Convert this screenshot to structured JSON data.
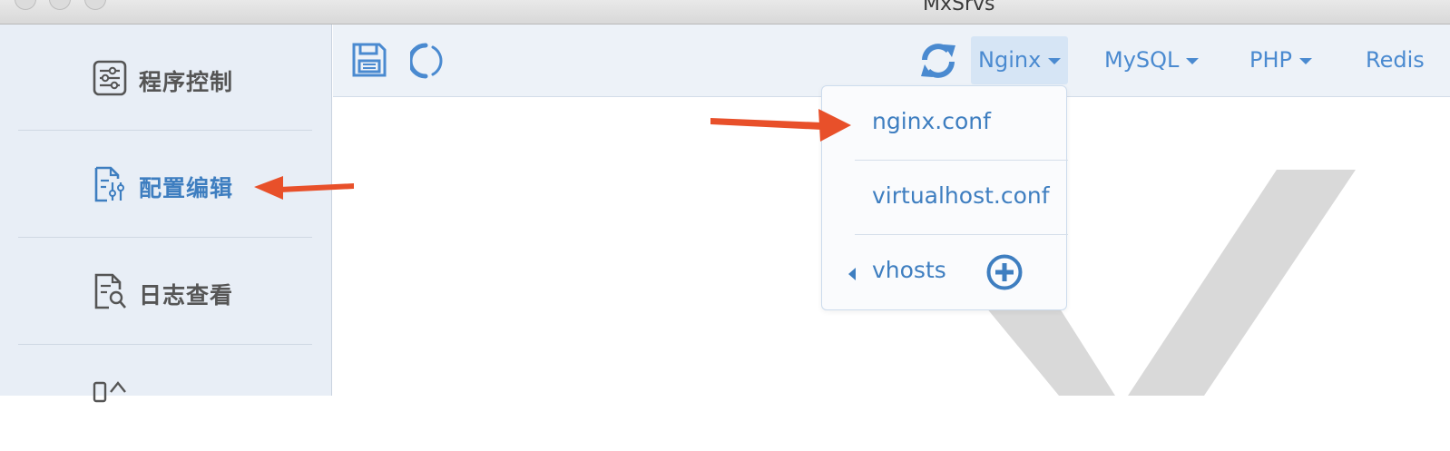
{
  "window": {
    "title": "MxSrvs"
  },
  "sidebar": {
    "items": [
      {
        "label": "程序控制",
        "icon": "sliders-panel-icon",
        "active": false
      },
      {
        "label": "配置编辑",
        "icon": "config-edit-icon",
        "active": true
      },
      {
        "label": "日志查看",
        "icon": "log-view-icon",
        "active": false
      }
    ]
  },
  "toolbar": {
    "save_icon": "save-icon",
    "loading_icon": "loading-spinner-icon",
    "refresh_icon": "refresh-icon",
    "menus": [
      {
        "label": "Nginx",
        "open": true
      },
      {
        "label": "MySQL",
        "open": false
      },
      {
        "label": "PHP",
        "open": false
      },
      {
        "label": "Redis",
        "open": false
      }
    ]
  },
  "dropdown": {
    "items": [
      {
        "label": "nginx.conf"
      },
      {
        "label": "virtualhost.conf"
      },
      {
        "label": "vhosts",
        "has_submenu": true,
        "add_icon": "plus-circle-icon"
      }
    ]
  },
  "colors": {
    "accent": "#3e7ec0",
    "sidebar_bg": "#e8eef6",
    "annotation_arrow": "#e8502a",
    "watermark": "#d9d9d9"
  }
}
